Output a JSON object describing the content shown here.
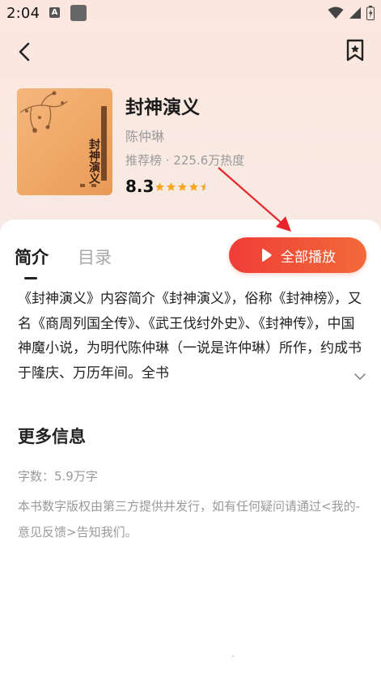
{
  "status_bar": {
    "time": "2:04",
    "a_icon": "A"
  },
  "book": {
    "title": "封神演义",
    "author": "陈仲琳",
    "rank": "推荐榜 · 225.6万热度",
    "score": "8.3",
    "rating_stars": 4.5,
    "cover_text": "封神演义"
  },
  "tabs": {
    "intro": "简介",
    "catalog": "目录"
  },
  "play_button": {
    "label": "全部播放"
  },
  "description": "《封神演义》内容简介《封神演义》，俗称《封神榜》，又名《商周列国全传》、《武王伐纣外史》、《封神传》，中国神魔小说，为明代陈仲琳（一说是许仲琳）所作，约成书于隆庆、万历年间。全书",
  "more_info": {
    "title": "更多信息",
    "word_count": "字数：5.9万字",
    "copyright": "本书数字版权由第三方提供并发行，如有任何疑问请通过<我的-意见反馈>告知我们。"
  },
  "colors": {
    "accent": "#ef3d37",
    "annotation": "#e8262a",
    "star": "#f5a623"
  },
  "icons": [
    "back-arrow-icon",
    "bookmark-star-icon",
    "play-icon",
    "chevron-down-icon",
    "wifi-icon",
    "signal-icon",
    "battery-icon"
  ]
}
